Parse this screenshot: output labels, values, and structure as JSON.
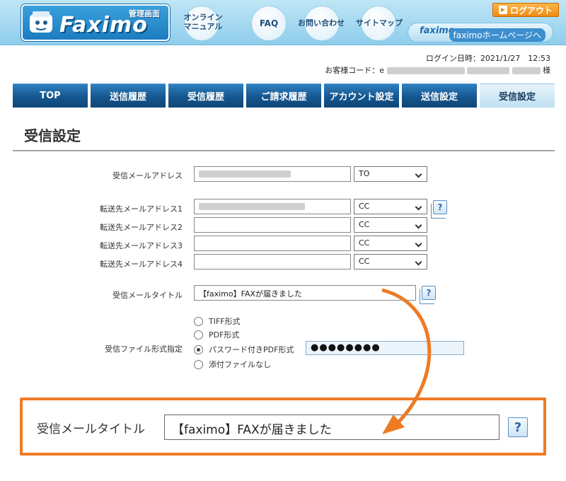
{
  "header": {
    "logo_text": "Faximo",
    "logo_sub": "管理画面",
    "links": {
      "manual_line1": "オンライン",
      "manual_line2": "マニュアル",
      "faq": "FAQ",
      "contact": "お問い合わせ",
      "sitemap": "サイトマップ"
    },
    "logout": "ログアウト",
    "home_logo": "faximo",
    "home_text": "faximoホームページへ"
  },
  "login_info": {
    "datetime_label": "ログイン日時：",
    "datetime_value": "2021/1/27　12:53",
    "customer_label": "お客様コード：",
    "customer_prefix": "e",
    "customer_suffix": "様"
  },
  "nav": {
    "tabs": [
      "TOP",
      "送信履歴",
      "受信履歴",
      "ご請求履歴",
      "アカウント設定",
      "送信設定",
      "受信設定"
    ],
    "active_index": 6
  },
  "page": {
    "title": "受信設定"
  },
  "form": {
    "receive_email_label": "受信メールアドレス",
    "receive_email_select": "TO",
    "forward_labels": [
      "転送先メールアドレス1",
      "転送先メールアドレス2",
      "転送先メールアドレス3",
      "転送先メールアドレス4"
    ],
    "forward_selects": [
      "CC",
      "CC",
      "CC",
      "CC"
    ],
    "title_label": "受信メールタイトル",
    "title_value": "【faximo】FAXが届きました",
    "format_label": "受信ファイル形式指定",
    "format_options": [
      "TIFF形式",
      "PDF形式",
      "パスワード付きPDF形式",
      "添付ファイルなし"
    ],
    "format_selected_index": 2,
    "password_mask": "●●●●●●●●",
    "help_glyph": "?"
  },
  "callout": {
    "label": "受信メールタイトル",
    "value": "【faximo】FAXが届きました"
  },
  "colors": {
    "nav_blue": "#15578f",
    "accent_orange": "#ee7b24",
    "header_sky": "#8fcdec"
  }
}
